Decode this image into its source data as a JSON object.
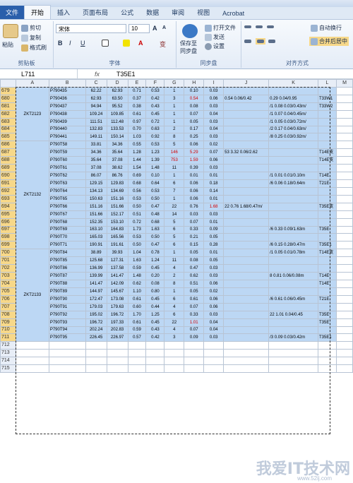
{
  "ribbon": {
    "tabs": [
      "文件",
      "开始",
      "插入",
      "页面布局",
      "公式",
      "数据",
      "审阅",
      "视图",
      "Acrobat"
    ],
    "clipboard": {
      "paste": "粘贴",
      "cut": "剪切",
      "copy": "复制",
      "format_painter": "格式刷",
      "label": "剪贴板"
    },
    "font": {
      "name": "宋体",
      "size": "10",
      "label": "字体",
      "bold": "B",
      "italic": "I",
      "underline": "U",
      "grow": "A",
      "shrink": "A",
      "wen": "变"
    },
    "sync": {
      "save_to": "保存至",
      "sync_disk": "同步盘",
      "open_file": "打开文件",
      "send": "发送",
      "settings": "设置",
      "label": "同步盘"
    },
    "align": {
      "wrap": "自动换行",
      "merge": "合并后居中",
      "label": "对齐方式"
    }
  },
  "formula_bar": {
    "cell_ref": "L711",
    "fx": "fx",
    "value": "T35E1"
  },
  "columns": [
    "A",
    "B",
    "C",
    "D",
    "E",
    "F",
    "G",
    "H",
    "I",
    "J",
    "K",
    "L",
    "M"
  ],
  "rows": [
    {
      "n": "679",
      "b": "P790435",
      "c": "62.22",
      "d": "62.93",
      "e": "0.71",
      "f": "0.53",
      "g": "1",
      "h": "0.10",
      "i": "0.03",
      "j": "",
      "k": "",
      "l": ""
    },
    {
      "n": "680",
      "b": "P790436",
      "c": "62.93",
      "d": "63.50",
      "e": "0.37",
      "f": "0.42",
      "g": "3",
      "h": "0.54",
      "i": "0.06",
      "j": "0.54 0.06/0.42",
      "k": "0.29 0.04/0.95",
      "l": "T33W1",
      "hred": true
    },
    {
      "n": "681",
      "b": "P790437",
      "c": "94.94",
      "d": "95.52",
      "e": "0.38",
      "f": "0.43",
      "g": "1",
      "h": "0.08",
      "i": "0.03",
      "j": "",
      "k": "/1 0.08 0.03/0.43m/",
      "l": "T33W2"
    },
    {
      "n": "682",
      "b": "P790438",
      "c": "109.24",
      "d": "109.85",
      "e": "0.61",
      "f": "0.45",
      "g": "1",
      "h": "0.07",
      "i": "0.04",
      "j": "",
      "k": "/1 0.07 0.04/0.45m/",
      "l": ""
    },
    {
      "n": "683",
      "b": "P790439",
      "c": "111.51",
      "d": "112.48",
      "e": "0.97",
      "f": "0.72",
      "g": "1",
      "h": "0.05",
      "i": "0.03",
      "j": "",
      "k": "/1 0.05 0.03/0.72m/",
      "l": ""
    },
    {
      "n": "684",
      "b": "P790440",
      "c": "132.83",
      "d": "133.53",
      "e": "0.70",
      "f": "0.63",
      "g": "2",
      "h": "0.17",
      "i": "0.04",
      "j": "",
      "k": "/2 0.17 0.04/0.63m/",
      "l": ""
    },
    {
      "n": "685",
      "b": "P790441",
      "c": "149.11",
      "d": "150.14",
      "e": "1.03",
      "f": "0.92",
      "g": "8",
      "h": "0.25",
      "i": "0.03",
      "j": "",
      "k": "/8 0.25 0.03/0.92m/",
      "l": ""
    },
    {
      "n": "686",
      "b": "P790T58",
      "c": "33.81",
      "d": "34.36",
      "e": "0.55",
      "f": "0.53",
      "g": "5",
      "h": "0.06",
      "i": "0.02",
      "j": "",
      "k": "",
      "l": ""
    },
    {
      "n": "687",
      "b": "P790T59",
      "c": "34.36",
      "d": "35.64",
      "e": "1.28",
      "f": "1.23",
      "g": "146",
      "h": "5.29",
      "i": "0.07",
      "j": "53 3.32 0.06/2.62",
      "k": "",
      "l": "T14E支",
      "gred": true,
      "hred": true
    },
    {
      "n": "688",
      "b": "P790T60",
      "c": "35.64",
      "d": "37.08",
      "e": "1.44",
      "f": "1.39",
      "g": "753",
      "h": "1.59",
      "i": "0.06",
      "j": "",
      "k": "",
      "l": "T14E支",
      "gred": true,
      "hred": true
    },
    {
      "n": "689",
      "b": "P790T61",
      "c": "37.08",
      "d": "38.62",
      "e": "1.54",
      "f": "1.48",
      "g": "11",
      "h": "0.39",
      "i": "0.03",
      "j": "",
      "k": "",
      "l": ""
    },
    {
      "n": "690",
      "b": "P790T62",
      "c": "86.07",
      "d": "86.76",
      "e": "0.69",
      "f": "0.10",
      "g": "1",
      "h": "0.01",
      "i": "0.01",
      "j": "",
      "k": "/1 0.01 0.01/0.10m",
      "l": "T14E"
    },
    {
      "n": "691",
      "b": "P790T63",
      "c": "129.15",
      "d": "129.83",
      "e": "0.68",
      "f": "0.64",
      "g": "6",
      "h": "0.06",
      "i": "0.18",
      "j": "",
      "k": "/6 0.06 0.18/0.64m",
      "l": "T21E"
    },
    {
      "n": "692",
      "b": "P790T64",
      "c": "134.13",
      "d": "134.69",
      "e": "0.56",
      "f": "0.53",
      "g": "7",
      "h": "0.06",
      "i": "0.14",
      "j": "",
      "k": "",
      "l": ""
    },
    {
      "n": "693",
      "b": "P790T65",
      "c": "150.63",
      "d": "151.16",
      "e": "0.53",
      "f": "0.50",
      "g": "1",
      "h": "0.06",
      "i": "0.01",
      "j": "",
      "k": "",
      "l": ""
    },
    {
      "n": "694",
      "b": "P790T66",
      "c": "151.16",
      "d": "151.66",
      "e": "0.50",
      "f": "0.47",
      "g": "22",
      "h": "0.76",
      "i": "1.68",
      "j": "22 0.76 1.68/0.47m/",
      "k": "",
      "l": "T35E支",
      "ired": true
    },
    {
      "n": "695",
      "b": "P790T67",
      "c": "151.66",
      "d": "152.17",
      "e": "0.51",
      "f": "0.48",
      "g": "14",
      "h": "0.03",
      "i": "0.03",
      "j": "",
      "k": "",
      "l": ""
    },
    {
      "n": "696",
      "b": "P790T68",
      "c": "152.35",
      "d": "153.10",
      "e": "0.72",
      "f": "0.68",
      "g": "5",
      "h": "0.07",
      "i": "0.01",
      "j": "",
      "k": "",
      "l": ""
    },
    {
      "n": "697",
      "b": "P790T69",
      "c": "163.10",
      "d": "164.83",
      "e": "1.73",
      "f": "1.63",
      "g": "6",
      "h": "0.33",
      "i": "0.09",
      "j": "",
      "k": "/6 0.33 0.09/1.63m",
      "l": "T35E"
    },
    {
      "n": "698",
      "b": "P790T70",
      "c": "165.03",
      "d": "165.56",
      "e": "0.53",
      "f": "0.50",
      "g": "5",
      "h": "0.21",
      "i": "0.05",
      "j": "",
      "k": "",
      "l": ""
    },
    {
      "n": "699",
      "b": "P790T71",
      "c": "190.91",
      "d": "191.61",
      "e": "0.50",
      "f": "0.47",
      "g": "6",
      "h": "0.15",
      "i": "0.28",
      "j": "",
      "k": "/6 0.15 0.28/0.47m",
      "l": "T35E1"
    },
    {
      "n": "700",
      "b": "P790T84",
      "c": "38.89",
      "d": "39.93",
      "e": "1.04",
      "f": "0.78",
      "g": "1",
      "h": "0.05",
      "i": "0.01",
      "j": "",
      "k": "/1 0.05 0.01/0.78m",
      "l": "T14E支"
    },
    {
      "n": "701",
      "b": "P790T85",
      "c": "125.68",
      "d": "127.31",
      "e": "1.63",
      "f": "1.24",
      "g": "11",
      "h": "0.08",
      "i": "0.05",
      "j": "",
      "k": "",
      "l": ""
    },
    {
      "n": "702",
      "b": "P790T86",
      "c": "136.99",
      "d": "137.58",
      "e": "0.59",
      "f": "0.45",
      "g": "4",
      "h": "0.47",
      "i": "0.03",
      "j": "",
      "k": "",
      "l": ""
    },
    {
      "n": "703",
      "b": "P790T87",
      "c": "139.99",
      "d": "141.47",
      "e": "1.48",
      "f": "0.20",
      "g": "2",
      "h": "0.62",
      "i": "0.03",
      "j": "",
      "k": "8 0.81 0.06/0.08m",
      "l": "T14E"
    },
    {
      "n": "704",
      "b": "P790T88",
      "c": "141.47",
      "d": "142.09",
      "e": "0.62",
      "f": "0.08",
      "g": "8",
      "h": "0.51",
      "i": "0.06",
      "j": "",
      "k": "",
      "l": "T14E"
    },
    {
      "n": "705",
      "b": "P790T89",
      "c": "144.97",
      "d": "145.67",
      "e": "1.10",
      "f": "0.80",
      "g": "1",
      "h": "0.05",
      "i": "0.02",
      "j": "",
      "k": "",
      "l": ""
    },
    {
      "n": "706",
      "b": "P790T90",
      "c": "172.47",
      "d": "173.08",
      "e": "0.61",
      "f": "0.45",
      "g": "6",
      "h": "0.61",
      "i": "0.06",
      "j": "",
      "k": "/6 0.61 0.06/0.45m",
      "l": "T21E"
    },
    {
      "n": "707",
      "b": "P790T91",
      "c": "179.03",
      "d": "179.63",
      "e": "0.60",
      "f": "0.44",
      "g": "4",
      "h": "0.07",
      "i": "0.06",
      "j": "",
      "k": "",
      "l": ""
    },
    {
      "n": "708",
      "b": "P790T92",
      "c": "195.02",
      "d": "196.72",
      "e": "1.70",
      "f": "1.25",
      "g": "6",
      "h": "0.33",
      "i": "0.03",
      "j": "",
      "k": "22 1.01 0.04/0.45",
      "l": "T35E"
    },
    {
      "n": "709",
      "b": "P790T93",
      "c": "196.72",
      "d": "197.33",
      "e": "0.61",
      "f": "0.45",
      "g": "22",
      "h": "1.01",
      "i": "0.04",
      "j": "",
      "k": "",
      "l": "T35E",
      "hred": true
    },
    {
      "n": "710",
      "b": "P790T94",
      "c": "202.24",
      "d": "202.83",
      "e": "0.59",
      "f": "0.43",
      "g": "4",
      "h": "0.07",
      "i": "0.04",
      "j": "",
      "k": "",
      "l": ""
    },
    {
      "n": "711",
      "b": "P790T95",
      "c": "226.45",
      "d": "226.97",
      "e": "0.57",
      "f": "0.42",
      "g": "3",
      "h": "0.09",
      "i": "0.03",
      "j": "",
      "k": "/3 0.09 0.03/0.42m",
      "l": "T35E1"
    },
    {
      "n": "712",
      "b": "",
      "c": "",
      "d": "",
      "e": "",
      "f": "",
      "g": "",
      "h": "",
      "i": "",
      "j": "",
      "k": "",
      "l": ""
    },
    {
      "n": "713",
      "b": "",
      "c": "",
      "d": "",
      "e": "",
      "f": "",
      "g": "",
      "h": "",
      "i": "",
      "j": "",
      "k": "",
      "l": ""
    },
    {
      "n": "714",
      "b": "",
      "c": "",
      "d": "",
      "e": "",
      "f": "",
      "g": "",
      "h": "",
      "i": "",
      "j": "",
      "k": "",
      "l": ""
    },
    {
      "n": "715",
      "b": "",
      "c": "",
      "d": "",
      "e": "",
      "f": "",
      "g": "",
      "h": "",
      "i": "",
      "j": "",
      "k": "",
      "l": ""
    }
  ],
  "groups": [
    {
      "label": "ZKT2123",
      "start": 0,
      "span": 7
    },
    {
      "label": "ZKT2132",
      "start": 7,
      "span": 14
    },
    {
      "label": "ZKT2133",
      "start": 21,
      "span": 12
    }
  ],
  "watermark": {
    "text": "我爱IT技术网",
    "url": "www.52ij.com"
  }
}
